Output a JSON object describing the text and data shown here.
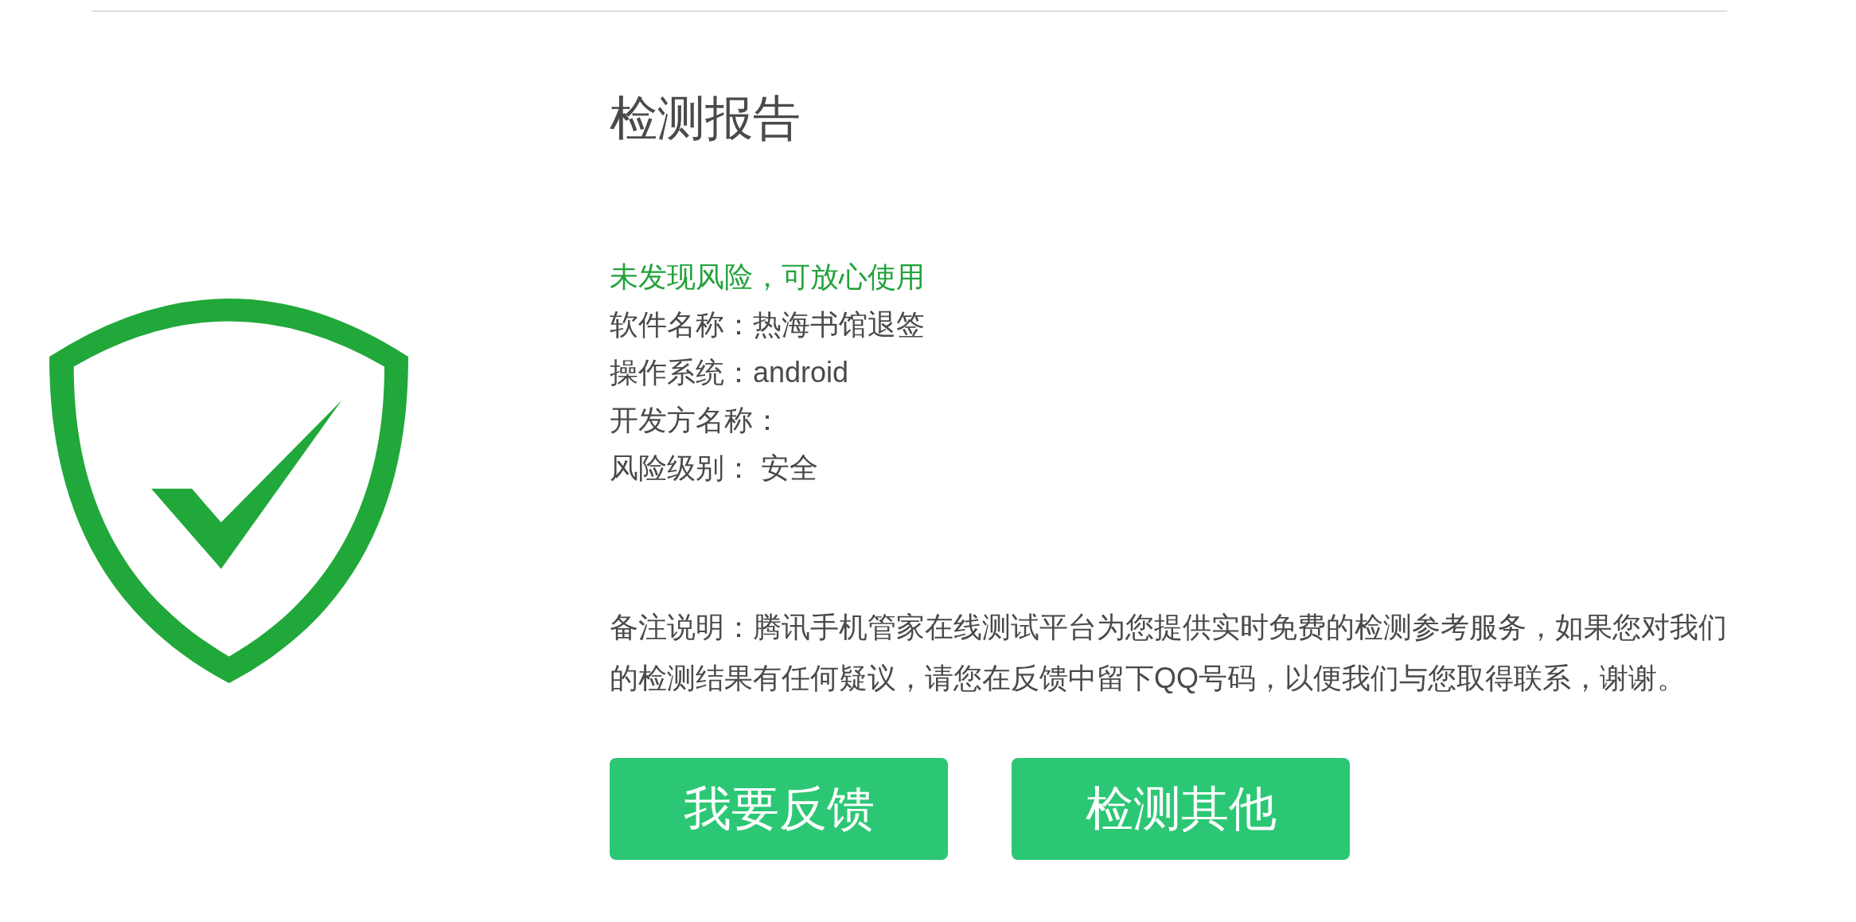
{
  "report": {
    "title": "检测报告"
  },
  "result": {
    "status": "未发现风险，可放心使用",
    "safe": true
  },
  "details": [
    "软件名称：热海书馆退签",
    "操作系统：android",
    "开发方名称：",
    "风险级别： 安全"
  ],
  "note": "备注说明：腾讯手机管家在线测试平台为您提供实时免费的检测参考服务，如果您对我们的检测结果有任何疑议，请您在反馈中留下QQ号码，以便我们与您取得联系，谢谢。",
  "buttons": [
    "我要反馈",
    "检测其他"
  ]
}
